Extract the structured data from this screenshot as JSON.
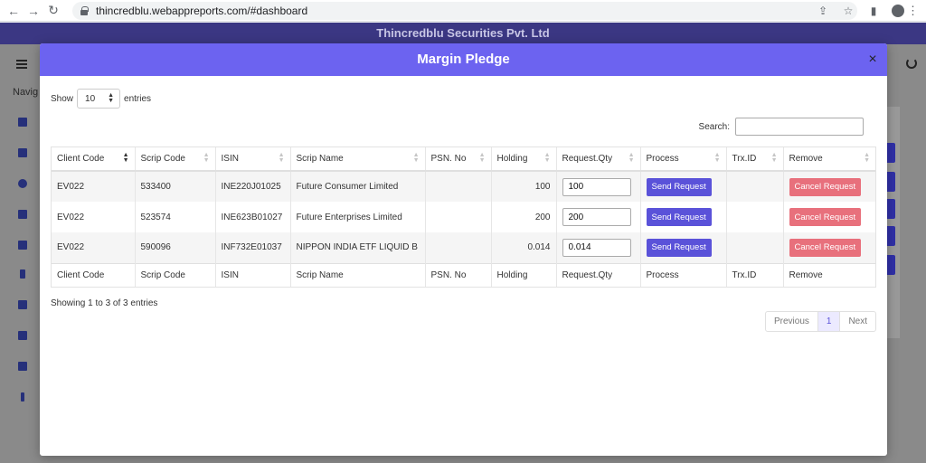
{
  "browser": {
    "url": "thincredblu.webappreports.com/#dashboard"
  },
  "app": {
    "company": "Thincredblu Securities Pvt. Ltd",
    "nav_label": "Navig"
  },
  "modal": {
    "title": "Margin Pledge",
    "close_symbol": "×",
    "show_label": "Show",
    "entries_value": "10",
    "entries_label": "entries",
    "search_label": "Search:",
    "search_value": "",
    "columns": [
      "Client Code",
      "Scrip Code",
      "ISIN",
      "Scrip Name",
      "PSN. No",
      "Holding",
      "Request.Qty",
      "Process",
      "Trx.ID",
      "Remove"
    ],
    "rows": [
      {
        "client_code": "EV022",
        "scrip_code": "533400",
        "isin": "INE220J01025",
        "scrip_name": "Future Consumer Limited",
        "psn_no": "",
        "holding": "100",
        "request_qty": "100",
        "process": "Send Request",
        "trx_id": "",
        "remove": "Cancel Request"
      },
      {
        "client_code": "EV022",
        "scrip_code": "523574",
        "isin": "INE623B01027",
        "scrip_name": "Future Enterprises Limited",
        "psn_no": "",
        "holding": "200",
        "request_qty": "200",
        "process": "Send Request",
        "trx_id": "",
        "remove": "Cancel Request"
      },
      {
        "client_code": "EV022",
        "scrip_code": "590096",
        "isin": "INF732E01037",
        "scrip_name": "NIPPON INDIA ETF LIQUID B",
        "psn_no": "",
        "holding": "0.014",
        "request_qty": "0.014",
        "process": "Send Request",
        "trx_id": "",
        "remove": "Cancel Request"
      }
    ],
    "info": "Showing 1 to 3 of 3 entries",
    "pagination": {
      "previous": "Previous",
      "current": "1",
      "next": "Next"
    }
  },
  "colors": {
    "modal_header": "#6c63f0",
    "send_button": "#5a52d9",
    "cancel_button": "#e8707c",
    "app_header": "#3b3783"
  }
}
